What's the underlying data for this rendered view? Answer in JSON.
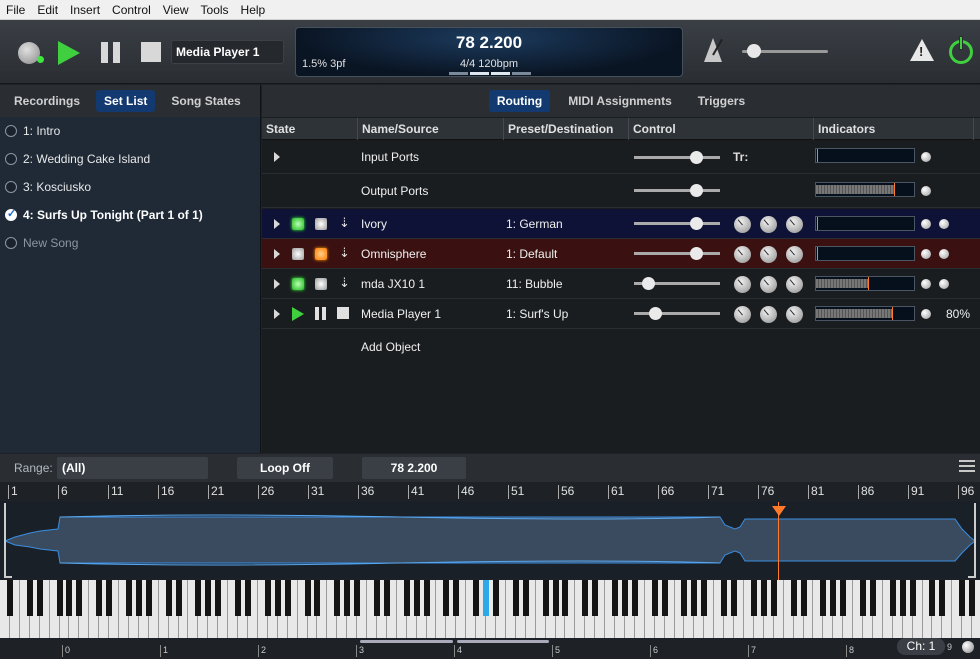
{
  "menu": [
    "File",
    "Edit",
    "Insert",
    "Control",
    "View",
    "Tools",
    "Help"
  ],
  "transport": {
    "media_player": "Media Player 1",
    "position": "78 2.200",
    "timesig_tempo": "4/4 120bpm",
    "cpu": "1.5%  3pf"
  },
  "left_tabs": [
    "Recordings",
    "Set List",
    "Song States"
  ],
  "songs": [
    {
      "label": "1: Intro",
      "selected": false
    },
    {
      "label": "2: Wedding Cake Island",
      "selected": false
    },
    {
      "label": "3: Kosciusko",
      "selected": false
    },
    {
      "label": "4: Surfs Up Tonight (Part 1 of 1)",
      "selected": true
    },
    {
      "label": "New Song",
      "selected": false
    }
  ],
  "main_tabs": [
    "Routing",
    "MIDI Assignments",
    "Triggers"
  ],
  "columns": [
    "State",
    "Name/Source",
    "Preset/Destination",
    "Control",
    "Indicators"
  ],
  "rows": [
    {
      "name": "Input Ports",
      "preset": "",
      "tuner": "Tr:"
    },
    {
      "name": "Output Ports",
      "preset": ""
    },
    {
      "name": "Ivory",
      "preset": "1: German"
    },
    {
      "name": "Omnisphere",
      "preset": "1: Default"
    },
    {
      "name": "mda JX10 1",
      "preset": "11: Bubble"
    },
    {
      "name": "Media Player 1",
      "preset": "1: Surf's Up",
      "percent": "80%"
    },
    {
      "name": "Add Object"
    }
  ],
  "bottom": {
    "range_label": "Range:",
    "range_value": "(All)",
    "loop": "Loop Off",
    "position": "78 2.200",
    "channel": "Ch: 1",
    "channel_num": "9"
  },
  "ruler_ticks": [
    "1",
    "6",
    "11",
    "16",
    "21",
    "26",
    "31",
    "36",
    "41",
    "46",
    "51",
    "56",
    "61",
    "66",
    "71",
    "76",
    "81",
    "86",
    "91",
    "96"
  ],
  "octave_labels": [
    "0",
    "1",
    "2",
    "3",
    "4",
    "5",
    "6",
    "7",
    "8"
  ],
  "colors": {
    "accent": "#133a70",
    "play": "#3fcf3f",
    "playhead": "#ff7a2a",
    "highlight_key": "#2ea8e8"
  }
}
